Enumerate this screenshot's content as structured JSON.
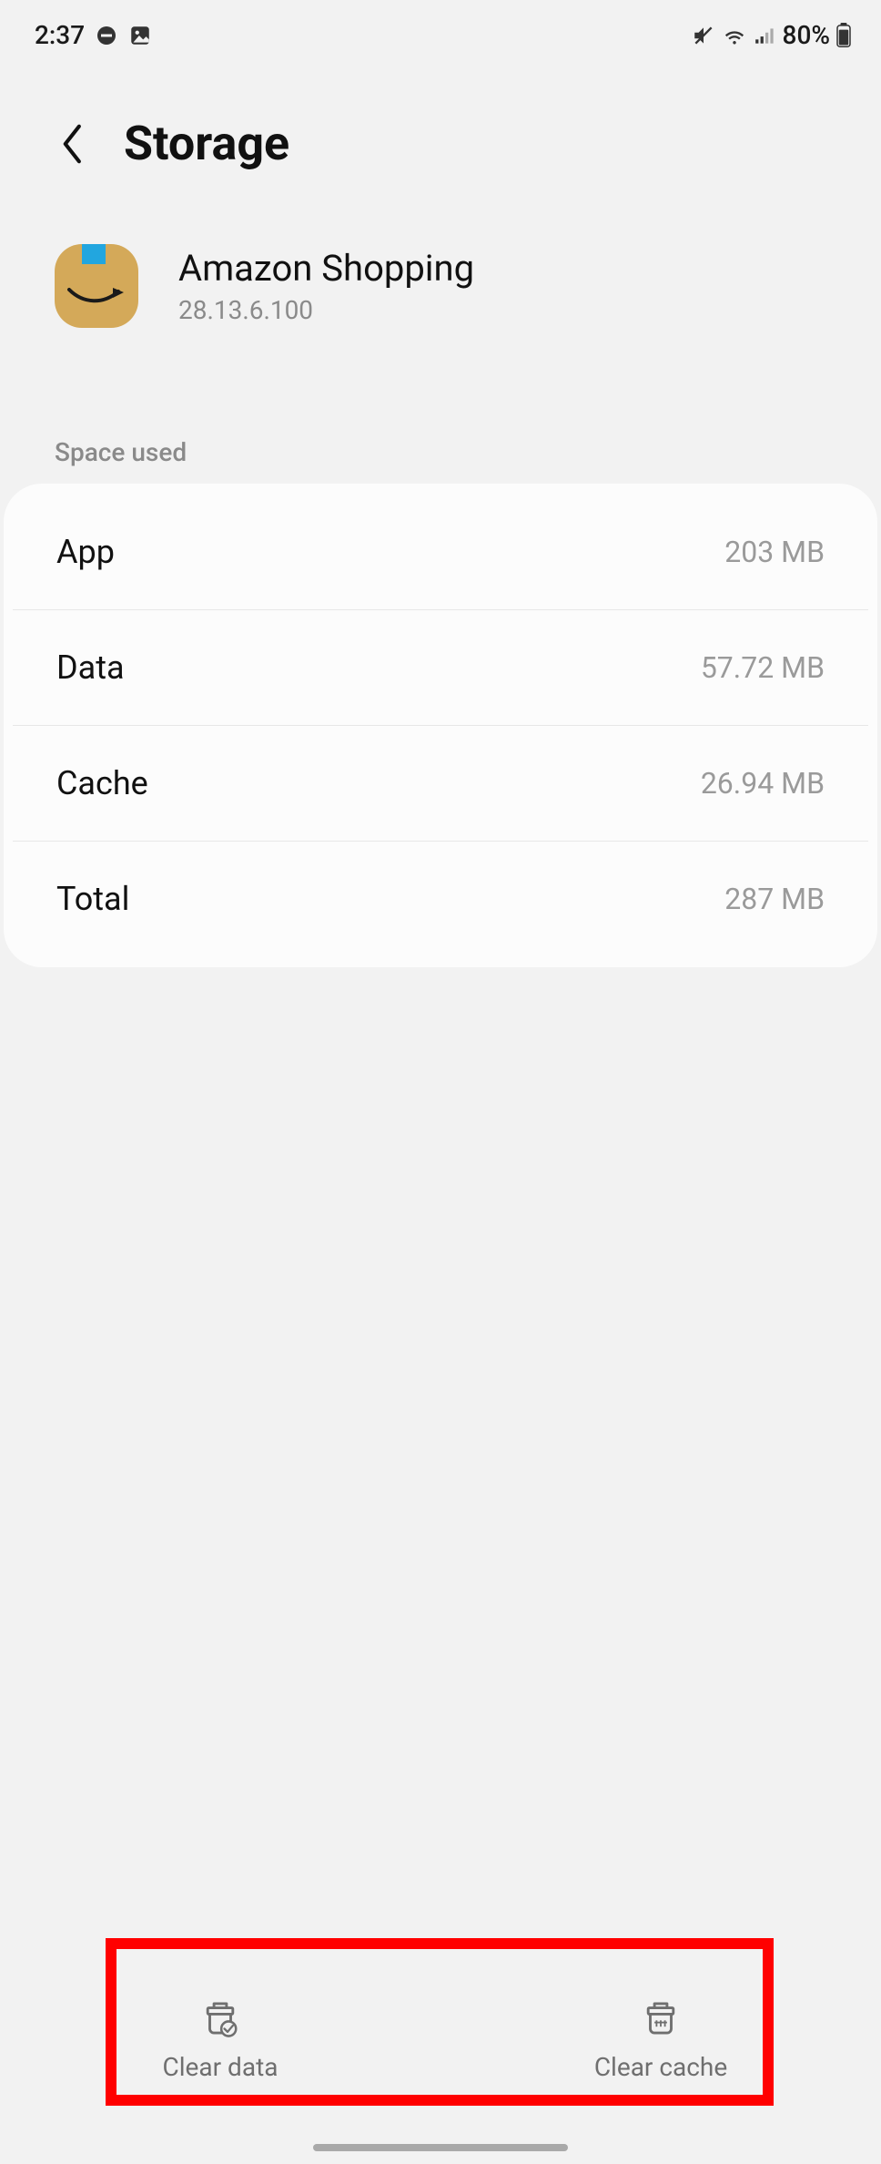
{
  "status": {
    "time": "2:37",
    "battery_text": "80%"
  },
  "header": {
    "title": "Storage"
  },
  "app": {
    "name": "Amazon Shopping",
    "version": "28.13.6.100"
  },
  "section": {
    "label": "Space used"
  },
  "rows": [
    {
      "label": "App",
      "value": "203 MB"
    },
    {
      "label": "Data",
      "value": "57.72 MB"
    },
    {
      "label": "Cache",
      "value": "26.94 MB"
    },
    {
      "label": "Total",
      "value": "287 MB"
    }
  ],
  "actions": {
    "clear_data": "Clear data",
    "clear_cache": "Clear cache"
  }
}
